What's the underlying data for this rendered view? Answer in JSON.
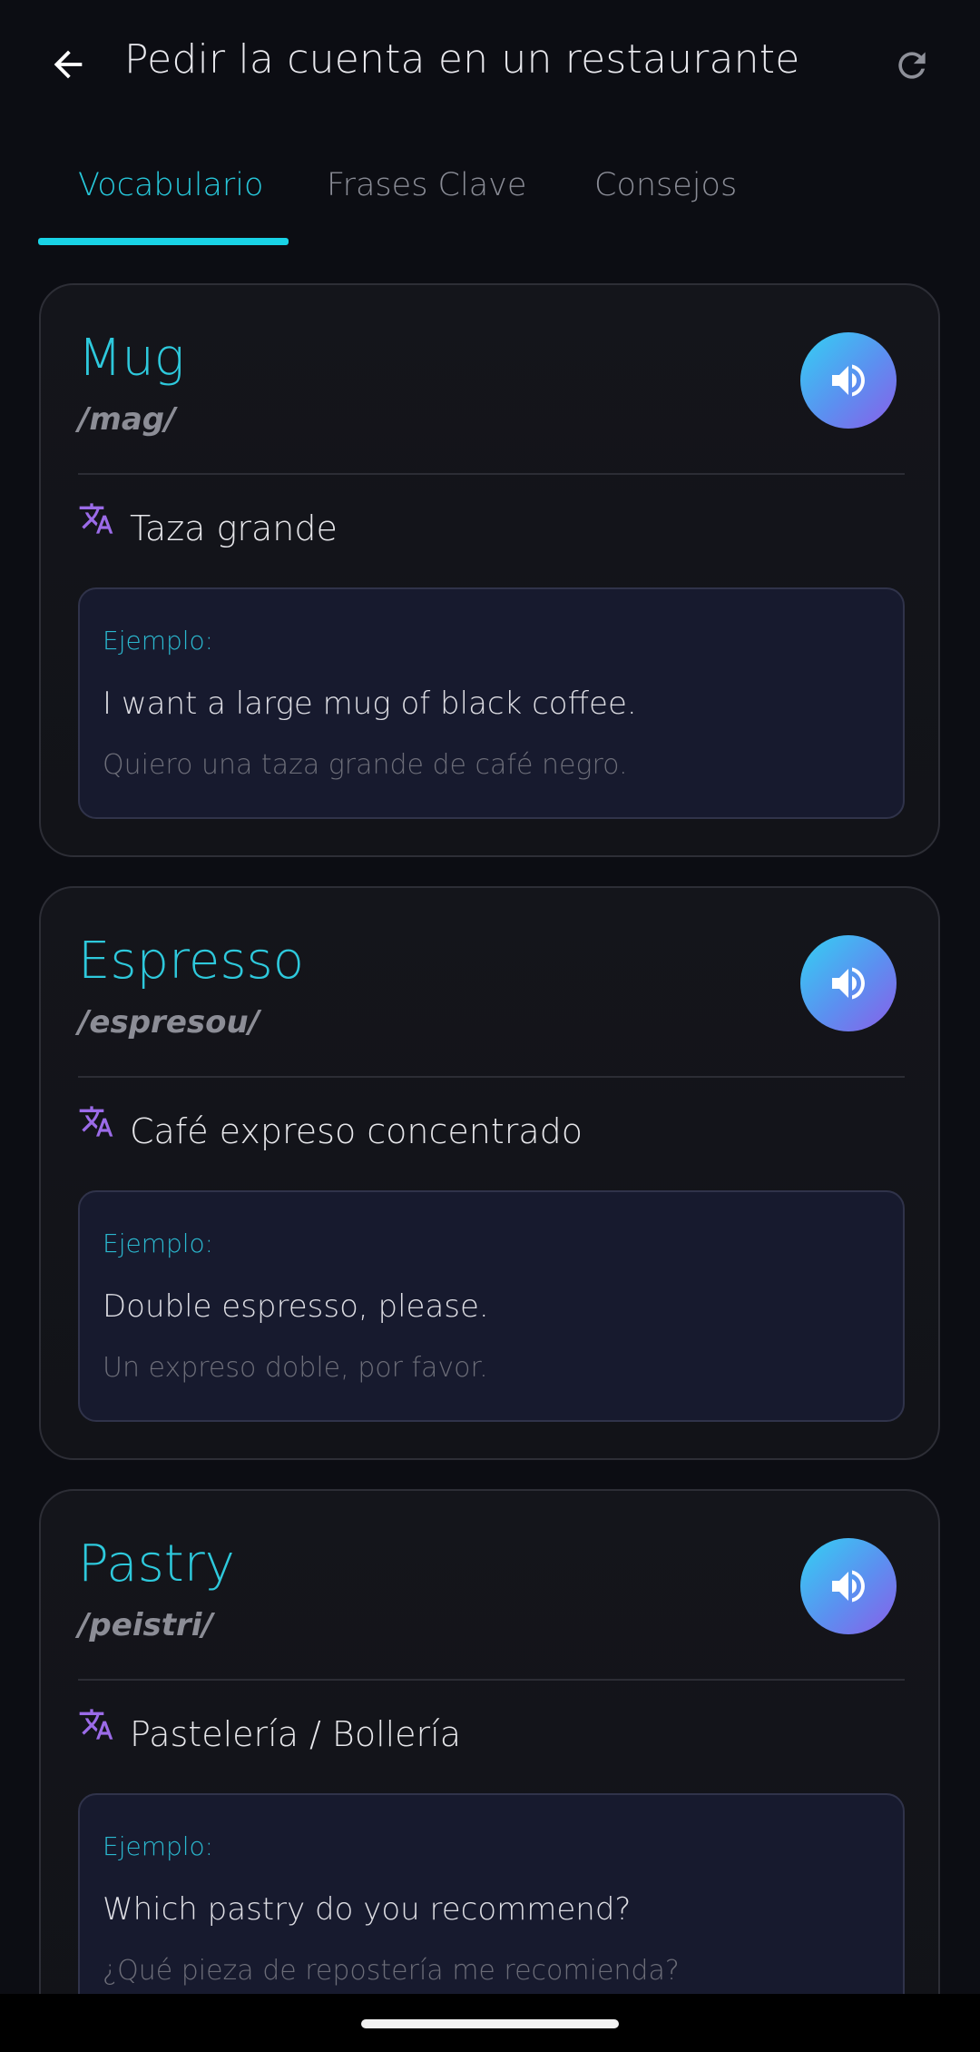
{
  "header": {
    "title": "Pedir la cuenta en un restaurante"
  },
  "tabs": [
    {
      "label": "Vocabulario",
      "active": true
    },
    {
      "label": "Frases Clave",
      "active": false
    },
    {
      "label": "Consejos",
      "active": false
    }
  ],
  "colors": {
    "accent": "#19d3e6",
    "example_bg": "#171a2e",
    "translate_icon": "#9b6be8"
  },
  "cards": [
    {
      "word": "Mug",
      "phonetic": "/mag/",
      "translation": "Taza grande",
      "example_label": "Ejemplo:",
      "example_en": "I want a large mug of black coffee.",
      "example_es": "Quiero una taza grande de café negro."
    },
    {
      "word": "Espresso",
      "phonetic": "/espresou/",
      "translation": "Café expreso concentrado",
      "example_label": "Ejemplo:",
      "example_en": "Double espresso, please.",
      "example_es": "Un expreso doble, por favor."
    },
    {
      "word": "Pastry",
      "phonetic": "/peistri/",
      "translation": "Pastelería / Bollería",
      "example_label": "Ejemplo:",
      "example_en": "Which pastry do you recommend?",
      "example_es": "¿Qué pieza de repostería me recomienda?"
    }
  ]
}
